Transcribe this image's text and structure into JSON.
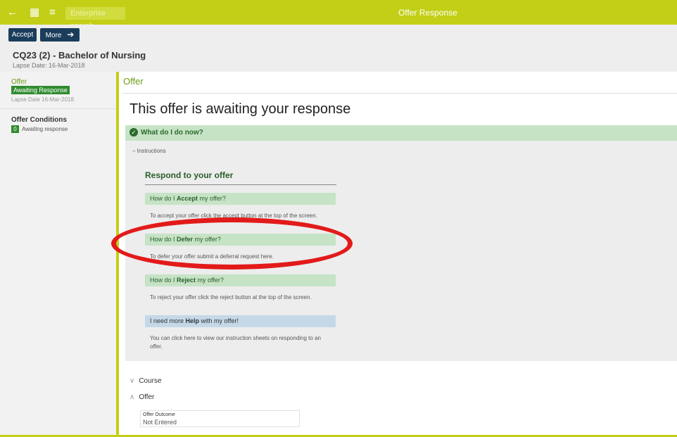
{
  "header": {
    "back_icon": "←",
    "apps_icon": "▦",
    "menu_icon": "≡",
    "search_placeholder": "Enterprise search",
    "title": "Offer Response"
  },
  "toolbar": {
    "accept_label": "Accept",
    "more_label": "More",
    "more_icon": "➔"
  },
  "course": {
    "name": "CQ23 (2) - Bachelor of Nursing",
    "lapse": "Lapse Date: 16-Mar-2018"
  },
  "sidebar": {
    "offer_label": "Offer",
    "status_badge": "Awaiting Response",
    "lapse": "Lapse Date 16-Mar-2018",
    "conditions_label": "Offer Conditions",
    "conditions_count": "0",
    "conditions_status": "Awaiting response"
  },
  "main": {
    "section_label": "Offer",
    "heading": "This offer is awaiting your response",
    "what_label": "What do I do now?",
    "instructions_label": "Instructions",
    "respond_title": "Respond to your offer",
    "items": [
      {
        "q_pre": "How do I ",
        "q_bold": "Accept",
        "q_post": " my offer?",
        "answer": "To accept your offer click the accept button at the top of the screen."
      },
      {
        "q_pre": "How do I ",
        "q_bold": "Defer",
        "q_post": " my offer?",
        "answer": "To defer your offer submit a deferral request here."
      },
      {
        "q_pre": "How do I ",
        "q_bold": "Reject",
        "q_post": " my offer?",
        "answer": "To reject your offer click the reject button at the top of the screen."
      },
      {
        "q_pre": "I need more ",
        "q_bold": "Help",
        "q_post": " with my offer!",
        "answer": "You can click here to view our instruction sheets on responding to an offer."
      }
    ],
    "course_section": "Course",
    "offer_section": "Offer",
    "outcome_label": "Offer Outcome",
    "outcome_value": "Not Entered"
  },
  "colors": {
    "accent": "#c3cf17",
    "button": "#1a3d5c",
    "green_text": "#6b9e16",
    "highlight_ring": "#e21a1a"
  }
}
